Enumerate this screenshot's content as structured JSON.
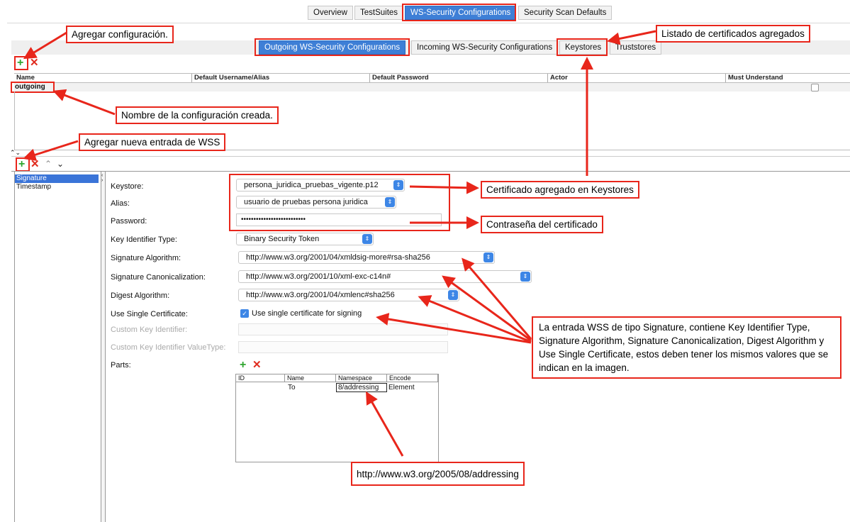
{
  "top_tabs": [
    "Overview",
    "TestSuites",
    "WS-Security Configurations",
    "Security Scan Defaults"
  ],
  "sub_tabs": [
    "Outgoing WS-Security Configurations",
    "Incoming WS-Security Configurations",
    "Keystores",
    "Truststores"
  ],
  "config_table": {
    "columns": [
      "Name",
      "Default Username/Alias",
      "Default Password",
      "Actor",
      "Must Understand"
    ],
    "rows": [
      {
        "name": "outgoing"
      }
    ]
  },
  "entries": [
    "Signature",
    "Timestamp"
  ],
  "form": {
    "keystore_label": "Keystore:",
    "keystore_value": "persona_juridica_pruebas_vigente.p12",
    "alias_label": "Alias:",
    "alias_value": "usuario de pruebas persona juridica",
    "password_label": "Password:",
    "password_value": "••••••••••••••••••••••••••",
    "key_identifier_label": "Key Identifier Type:",
    "key_identifier_value": "Binary Security Token",
    "sig_alg_label": "Signature Algorithm:",
    "sig_alg_value": "http://www.w3.org/2001/04/xmldsig-more#rsa-sha256",
    "sig_canon_label": "Signature Canonicalization:",
    "sig_canon_value": "http://www.w3.org/2001/10/xml-exc-c14n#",
    "digest_label": "Digest Algorithm:",
    "digest_value": "http://www.w3.org/2001/04/xmlenc#sha256",
    "single_cert_label": "Use Single Certificate:",
    "single_cert_checkbox": "Use single certificate for signing",
    "custom_key_label": "Custom Key Identifier:",
    "custom_key_vt_label": "Custom Key Identifier ValueType:",
    "parts_label": "Parts:"
  },
  "parts_table": {
    "columns": [
      "ID",
      "Name",
      "Namespace",
      "Encode"
    ],
    "rows": [
      {
        "id": "",
        "name": "To",
        "namespace": "8/addressing",
        "encode": "Element"
      }
    ]
  },
  "annotations": {
    "add_config": "Agregar configuración.",
    "cert_list": "Listado de certificados agregados",
    "config_name": "Nombre de la configuración creada.",
    "add_wss": "Agregar nueva entrada de WSS",
    "cert_added": "Certificado agregado en Keystores",
    "cert_password": "Contraseña del certificado",
    "signature_note": "La entrada WSS de tipo Signature, contiene Key Identifier Type, Signature Algorithm, Signature Canonicalization, Digest Algorithm y Use Single Certificate, estos deben tener los mismos valores que se indican en la imagen.",
    "addressing_url": "http://www.w3.org/2005/08/addressing"
  },
  "colors": {
    "accent": "#3e7fd6",
    "annotation": "#e8261b",
    "add": "#2ea52e",
    "remove": "#e02c1f"
  }
}
